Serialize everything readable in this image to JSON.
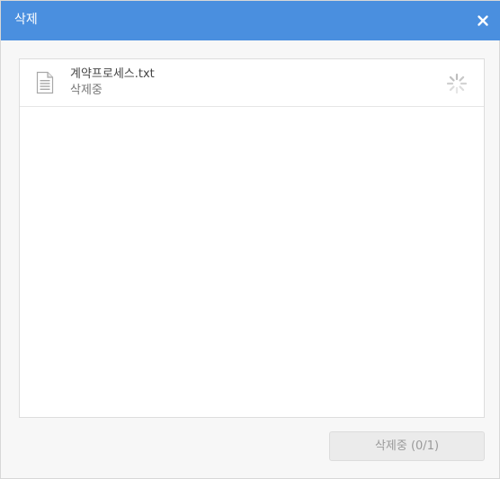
{
  "dialog": {
    "title": "삭제",
    "close_icon": "close-icon"
  },
  "files": [
    {
      "name": "계약프로세스.txt",
      "status": "삭제중",
      "icon": "document-icon",
      "progress_icon": "loading-spinner-icon"
    }
  ],
  "footer": {
    "button_label": "삭제중 (0/1)"
  },
  "colors": {
    "titlebar": "#4a8fdf",
    "background": "#f7f7f7",
    "button_bg": "#ebebeb",
    "button_text": "#9a9a9a"
  }
}
